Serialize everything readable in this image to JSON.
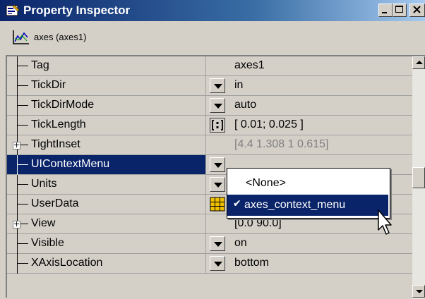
{
  "window": {
    "title": "Property Inspector",
    "controls": {
      "minimize": "_",
      "maximize": "□",
      "close": "×"
    }
  },
  "object_header": {
    "icon": "axes-plot-icon",
    "label": "axes (axes1)"
  },
  "properties": [
    {
      "name": "Tag",
      "editor": "none",
      "value": "axes1",
      "expandable": false
    },
    {
      "name": "TickDir",
      "editor": "dropdown",
      "value": "in",
      "expandable": false
    },
    {
      "name": "TickDirMode",
      "editor": "dropdown",
      "value": "auto",
      "expandable": false
    },
    {
      "name": "TickLength",
      "editor": "array",
      "value": "[ 0.01; 0.025 ]",
      "expandable": false
    },
    {
      "name": "TightInset",
      "editor": "none",
      "value": "[4.4 1.308 1 0.615]",
      "expandable": true,
      "expand_glyph": "+",
      "value_style": "disabled"
    },
    {
      "name": "UIContextMenu",
      "editor": "dropdown",
      "value": "",
      "expandable": false,
      "selected": true
    },
    {
      "name": "Units",
      "editor": "dropdown",
      "value": "",
      "expandable": false
    },
    {
      "name": "UserData",
      "editor": "grid",
      "value": "",
      "expandable": false
    },
    {
      "name": "View",
      "editor": "none",
      "value": "[0.0 90.0]",
      "expandable": true,
      "expand_glyph": "+"
    },
    {
      "name": "Visible",
      "editor": "dropdown",
      "value": "on",
      "expandable": false
    },
    {
      "name": "XAxisLocation",
      "editor": "dropdown",
      "value": "bottom",
      "expandable": false
    }
  ],
  "dropdown_popup": {
    "options": [
      {
        "label": "<None>",
        "selected": false
      },
      {
        "label": "axes_context_menu",
        "selected": true,
        "check": "✔"
      }
    ]
  },
  "colors": {
    "titlebar_start": "#0a246a",
    "titlebar_end": "#a6caf0",
    "selection": "#0a246a",
    "chrome": "#d4d0c8"
  }
}
